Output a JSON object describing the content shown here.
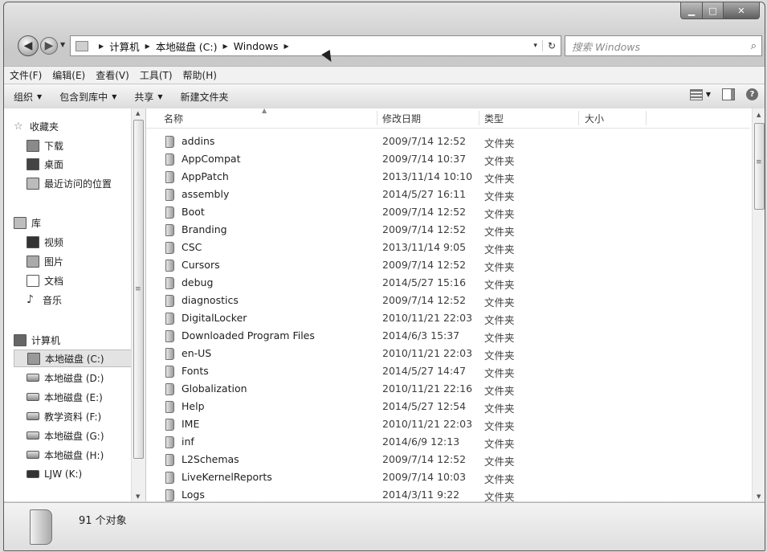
{
  "window": {
    "controls": [
      "▁",
      "□",
      "✕"
    ]
  },
  "address": {
    "crumbs": [
      "计算机",
      "本地磁盘 (C:)",
      "Windows"
    ],
    "dropdown_glyph": "▾",
    "refresh_glyph": "↻"
  },
  "search": {
    "placeholder": "搜索 Windows",
    "icon": "magnifier-icon"
  },
  "menu": [
    "文件(F)",
    "编辑(E)",
    "查看(V)",
    "工具(T)",
    "帮助(H)"
  ],
  "toolbar": {
    "organize": "组织",
    "include_in_library": "包含到库中",
    "share": "共享",
    "new_folder": "新建文件夹",
    "help_glyph": "?"
  },
  "nav": {
    "favorites": {
      "label": "收藏夹",
      "items": [
        "下载",
        "桌面",
        "最近访问的位置"
      ]
    },
    "libraries": {
      "label": "库",
      "items": [
        "视频",
        "图片",
        "文档",
        "音乐"
      ]
    },
    "computer": {
      "label": "计算机",
      "items": [
        "本地磁盘 (C:)",
        "本地磁盘 (D:)",
        "本地磁盘 (E:)",
        "教学资料 (F:)",
        "本地磁盘 (G:)",
        "本地磁盘 (H:)",
        "LJW (K:)"
      ]
    }
  },
  "columns": {
    "name": "名称",
    "date": "修改日期",
    "type": "类型",
    "size": "大小"
  },
  "files": [
    {
      "name": "addins",
      "date": "2009/7/14 12:52",
      "type": "文件夹"
    },
    {
      "name": "AppCompat",
      "date": "2009/7/14 10:37",
      "type": "文件夹"
    },
    {
      "name": "AppPatch",
      "date": "2013/11/14 10:10",
      "type": "文件夹"
    },
    {
      "name": "assembly",
      "date": "2014/5/27 16:11",
      "type": "文件夹"
    },
    {
      "name": "Boot",
      "date": "2009/7/14 12:52",
      "type": "文件夹"
    },
    {
      "name": "Branding",
      "date": "2009/7/14 12:52",
      "type": "文件夹"
    },
    {
      "name": "CSC",
      "date": "2013/11/14 9:05",
      "type": "文件夹"
    },
    {
      "name": "Cursors",
      "date": "2009/7/14 12:52",
      "type": "文件夹"
    },
    {
      "name": "debug",
      "date": "2014/5/27 15:16",
      "type": "文件夹"
    },
    {
      "name": "diagnostics",
      "date": "2009/7/14 12:52",
      "type": "文件夹"
    },
    {
      "name": "DigitalLocker",
      "date": "2010/11/21 22:03",
      "type": "文件夹"
    },
    {
      "name": "Downloaded Program Files",
      "date": "2014/6/3 15:37",
      "type": "文件夹"
    },
    {
      "name": "en-US",
      "date": "2010/11/21 22:03",
      "type": "文件夹"
    },
    {
      "name": "Fonts",
      "date": "2014/5/27 14:47",
      "type": "文件夹"
    },
    {
      "name": "Globalization",
      "date": "2010/11/21 22:16",
      "type": "文件夹"
    },
    {
      "name": "Help",
      "date": "2014/5/27 12:54",
      "type": "文件夹"
    },
    {
      "name": "IME",
      "date": "2010/11/21 22:03",
      "type": "文件夹"
    },
    {
      "name": "inf",
      "date": "2014/6/9 12:13",
      "type": "文件夹"
    },
    {
      "name": "L2Schemas",
      "date": "2009/7/14 12:52",
      "type": "文件夹"
    },
    {
      "name": "LiveKernelReports",
      "date": "2009/7/14 10:03",
      "type": "文件夹"
    },
    {
      "name": "Logs",
      "date": "2014/3/11 9:22",
      "type": "文件夹"
    }
  ],
  "status": {
    "count": "91 个对象"
  }
}
